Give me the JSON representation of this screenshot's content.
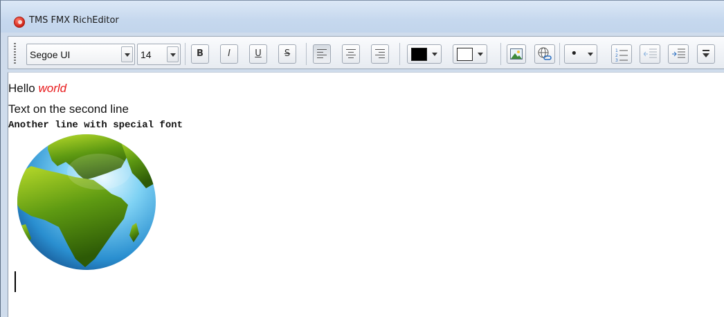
{
  "window": {
    "title": "TMS FMX RichEditor",
    "icon": "app-logo-icon"
  },
  "toolbar": {
    "font_name": "Segoe UI",
    "font_size": "14",
    "bold_label": "B",
    "italic_label": "I",
    "underline_label": "U",
    "strike_label": "S",
    "text_color": "#000000",
    "background_color": "#ffffff",
    "bullet_label": "•"
  },
  "document": {
    "line1": {
      "text": "Hello",
      "emphasis": "world",
      "emphasis_color": "#e8191b"
    },
    "line2": "Text on the second line",
    "line3": "Another line with special font",
    "image": "globe-image"
  }
}
